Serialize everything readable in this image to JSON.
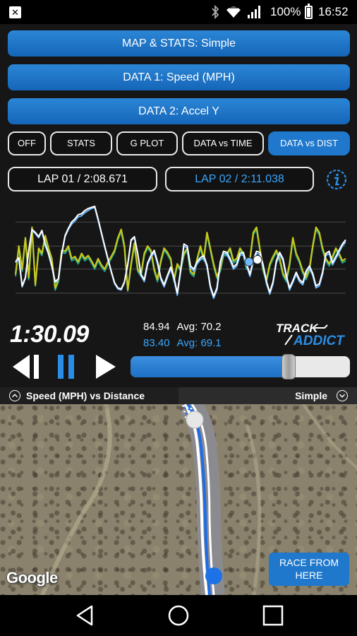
{
  "status_bar": {
    "notification_icon": "x-app-icon",
    "icons": [
      "bluetooth-icon",
      "wifi-icon",
      "cellular-signal-icon"
    ],
    "battery": "100%",
    "time": "16:52"
  },
  "menu": {
    "map_stats_label": "MAP & STATS: Simple",
    "data1_label": "DATA 1: Speed (MPH)",
    "data2_label": "DATA 2: Accel Y"
  },
  "tabs": [
    {
      "label": "OFF",
      "active": false
    },
    {
      "label": "STATS",
      "active": false
    },
    {
      "label": "G PLOT",
      "active": false
    },
    {
      "label": "DATA vs TIME",
      "active": false
    },
    {
      "label": "DATA vs DIST",
      "active": true
    }
  ],
  "laps": {
    "lap1": "LAP 01 / 2:08.671",
    "lap2": "LAP 02 / 2:11.038"
  },
  "readout": {
    "elapsed": "1:30.09",
    "lap1_value": "84.94",
    "lap1_avg": "Avg: 70.2",
    "lap2_value": "83.40",
    "lap2_avg": "Avg: 69.1"
  },
  "logo_text": {
    "main": "TRACK",
    "sub": "ADDICT"
  },
  "playback": {
    "progress": 0.72
  },
  "map_bar": {
    "left_label": "Speed (MPH) vs Distance",
    "right_label": "Simple"
  },
  "map": {
    "attribution": "Google",
    "race_button": "RACE FROM\nHERE"
  },
  "colors": {
    "accent": "#1f78cc",
    "lap2_text": "#3aa6ff",
    "speed_lap1": "#ffffff",
    "speed_lap2": "#6fb8ff",
    "accel_lap1": "#c9c81a",
    "accel_lap2": "#1fa08a"
  },
  "chart_data": {
    "type": "line",
    "title": "",
    "xlabel": "",
    "ylabel": "",
    "x": [
      0,
      1,
      2,
      3,
      4,
      5,
      6,
      7,
      8,
      9,
      10,
      11,
      12,
      13,
      14,
      15,
      16,
      17,
      18,
      19,
      20,
      21,
      22,
      23,
      24,
      25,
      26,
      27,
      28,
      29,
      30,
      31,
      32,
      33,
      34,
      35,
      36,
      37,
      38,
      39,
      40,
      41,
      42,
      43,
      44,
      45,
      46,
      47,
      48,
      49,
      50,
      51,
      52,
      53,
      54,
      55,
      56,
      57,
      58,
      59,
      60,
      61,
      62,
      63,
      64,
      65,
      66,
      67,
      68,
      69,
      70,
      71,
      72,
      73,
      74,
      75,
      76,
      77,
      78,
      79,
      80,
      81,
      82,
      83,
      84,
      85,
      86,
      87,
      88,
      89,
      90,
      91,
      92,
      93,
      94,
      95,
      96,
      97,
      98,
      99,
      100
    ],
    "series": [
      {
        "values": [
          0.47,
          0.51,
          0.24,
          0.32,
          0.58,
          0.78,
          0.75,
          0.71,
          0.77,
          0.64,
          0.55,
          0.43,
          0.28,
          0.31,
          0.55,
          0.72,
          0.79,
          0.85,
          0.88,
          0.92,
          0.93,
          0.96,
          0.98,
          0.99,
          1.0,
          0.88,
          0.75,
          0.62,
          0.5,
          0.38,
          0.27,
          0.22,
          0.21,
          0.28,
          0.45,
          0.68,
          0.71,
          0.55,
          0.35,
          0.3,
          0.46,
          0.53,
          0.58,
          0.47,
          0.32,
          0.25,
          0.34,
          0.42,
          0.32,
          0.17,
          0.39,
          0.64,
          0.62,
          0.43,
          0.4,
          0.47,
          0.51,
          0.53,
          0.44,
          0.24,
          0.14,
          0.22,
          0.47,
          0.57,
          0.56,
          0.5,
          0.42,
          0.45,
          0.55,
          0.56,
          0.45,
          0.35,
          0.49,
          0.57,
          0.56,
          0.44,
          0.28,
          0.18,
          0.28,
          0.48,
          0.56,
          0.5,
          0.34,
          0.22,
          0.29,
          0.37,
          0.3,
          0.27,
          0.38,
          0.43,
          0.36,
          0.24,
          0.26,
          0.37,
          0.55,
          0.57,
          0.46,
          0.52,
          0.58,
          0.64,
          0.68
        ]
      },
      {
        "values": [
          0.46,
          0.5,
          0.23,
          0.31,
          0.57,
          0.77,
          0.74,
          0.7,
          0.76,
          0.63,
          0.54,
          0.42,
          0.27,
          0.3,
          0.54,
          0.71,
          0.78,
          0.83,
          0.86,
          0.9,
          0.91,
          0.94,
          0.96,
          0.98,
          0.99,
          0.87,
          0.74,
          0.61,
          0.49,
          0.37,
          0.26,
          0.21,
          0.2,
          0.27,
          0.44,
          0.67,
          0.7,
          0.54,
          0.34,
          0.28,
          0.44,
          0.51,
          0.56,
          0.45,
          0.3,
          0.23,
          0.32,
          0.4,
          0.3,
          0.15,
          0.37,
          0.62,
          0.6,
          0.41,
          0.38,
          0.45,
          0.49,
          0.51,
          0.42,
          0.22,
          0.12,
          0.2,
          0.45,
          0.55,
          0.54,
          0.48,
          0.4,
          0.43,
          0.53,
          0.54,
          0.43,
          0.33,
          0.47,
          0.55,
          0.54,
          0.42,
          0.26,
          0.16,
          0.26,
          0.46,
          0.54,
          0.48,
          0.32,
          0.2,
          0.27,
          0.35,
          0.28,
          0.25,
          0.36,
          0.41,
          0.34,
          0.22,
          0.24,
          0.35,
          0.53,
          0.55,
          0.44,
          0.5,
          0.56,
          0.62,
          0.66
        ]
      },
      {
        "values": [
          0.35,
          0.62,
          0.4,
          0.7,
          0.32,
          0.8,
          0.25,
          0.6,
          0.55,
          0.72,
          0.6,
          0.5,
          0.22,
          0.3,
          0.58,
          0.57,
          0.62,
          0.5,
          0.52,
          0.47,
          0.55,
          0.5,
          0.53,
          0.48,
          0.42,
          0.5,
          0.44,
          0.4,
          0.47,
          0.52,
          0.58,
          0.7,
          0.78,
          0.62,
          0.2,
          0.45,
          0.65,
          0.4,
          0.35,
          0.55,
          0.62,
          0.58,
          0.4,
          0.3,
          0.48,
          0.6,
          0.56,
          0.5,
          0.3,
          0.45,
          0.4,
          0.55,
          0.6,
          0.38,
          0.35,
          0.5,
          0.62,
          0.5,
          0.75,
          0.6,
          0.45,
          0.33,
          0.4,
          0.55,
          0.55,
          0.6,
          0.48,
          0.5,
          0.6,
          0.55,
          0.42,
          0.5,
          0.75,
          0.8,
          0.6,
          0.4,
          0.3,
          0.45,
          0.52,
          0.58,
          0.5,
          0.36,
          0.3,
          0.45,
          0.7,
          0.55,
          0.48,
          0.38,
          0.32,
          0.4,
          0.62,
          0.8,
          0.75,
          0.6,
          0.5,
          0.45,
          0.52,
          0.6,
          0.55,
          0.48,
          0.5
        ]
      },
      {
        "values": [
          0.33,
          0.6,
          0.38,
          0.68,
          0.3,
          0.78,
          0.24,
          0.58,
          0.53,
          0.7,
          0.58,
          0.48,
          0.2,
          0.28,
          0.56,
          0.55,
          0.6,
          0.48,
          0.5,
          0.45,
          0.53,
          0.48,
          0.51,
          0.46,
          0.4,
          0.48,
          0.42,
          0.38,
          0.45,
          0.5,
          0.56,
          0.68,
          0.76,
          0.6,
          0.19,
          0.43,
          0.63,
          0.38,
          0.33,
          0.53,
          0.6,
          0.56,
          0.38,
          0.28,
          0.46,
          0.58,
          0.54,
          0.48,
          0.28,
          0.43,
          0.38,
          0.53,
          0.58,
          0.36,
          0.33,
          0.48,
          0.6,
          0.48,
          0.73,
          0.58,
          0.43,
          0.31,
          0.38,
          0.53,
          0.53,
          0.58,
          0.46,
          0.48,
          0.58,
          0.53,
          0.4,
          0.48,
          0.73,
          0.78,
          0.58,
          0.38,
          0.28,
          0.43,
          0.5,
          0.56,
          0.48,
          0.34,
          0.28,
          0.43,
          0.68,
          0.53,
          0.46,
          0.36,
          0.3,
          0.38,
          0.6,
          0.78,
          0.73,
          0.58,
          0.48,
          0.43,
          0.5,
          0.58,
          0.53,
          0.46,
          0.48
        ]
      }
    ],
    "cursor_x": 72,
    "grid": true,
    "legend": "none"
  }
}
